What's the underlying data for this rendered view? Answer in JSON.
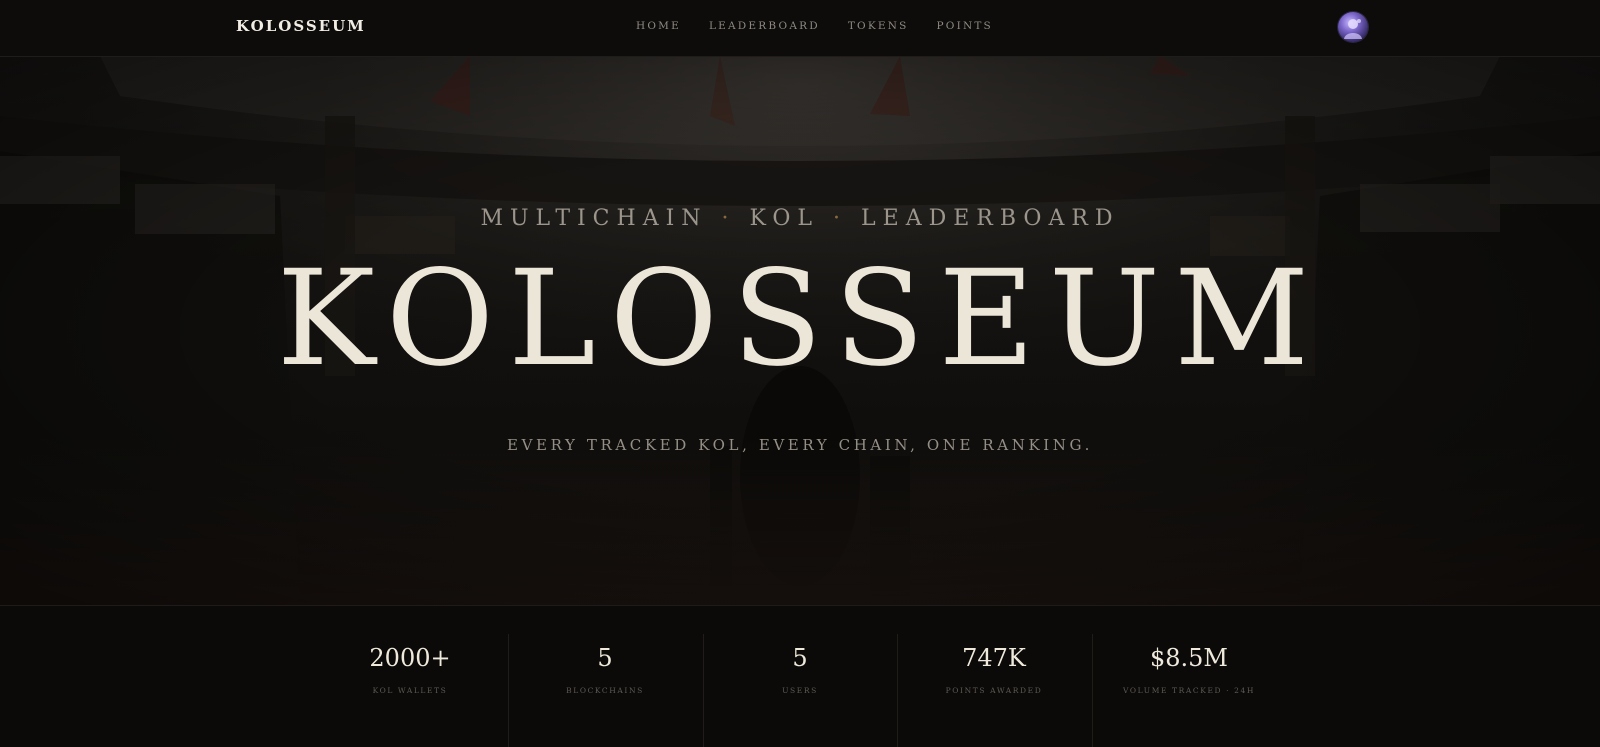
{
  "nav": {
    "brand": "KOLOSSEUM",
    "links": [
      "HOME",
      "LEADERBOARD",
      "TOKENS",
      "POINTS"
    ]
  },
  "hero": {
    "subtitle_parts": [
      "MULTICHAIN",
      "·",
      "KOL",
      "·",
      "LEADERBOARD"
    ],
    "title": "KOLOSSEUM",
    "tagline": "EVERY TRACKED KOL, EVERY CHAIN, ONE RANKING."
  },
  "stats": [
    {
      "value": "2000+",
      "label": "KOL WALLETS"
    },
    {
      "value": "5",
      "label": "BLOCKCHAINS"
    },
    {
      "value": "5",
      "label": "USERS"
    },
    {
      "value": "747K",
      "label": "POINTS AWARDED"
    },
    {
      "value": "$8.5M",
      "label": "VOLUME TRACKED · 24H"
    }
  ],
  "colors": {
    "background": "#0b0a09",
    "title": "#ece6d9",
    "muted": "#948f86",
    "accent_dot": "#8a6a3c",
    "avatar": "#7a64c8"
  },
  "icons": {
    "avatar": "user-avatar-icon"
  }
}
